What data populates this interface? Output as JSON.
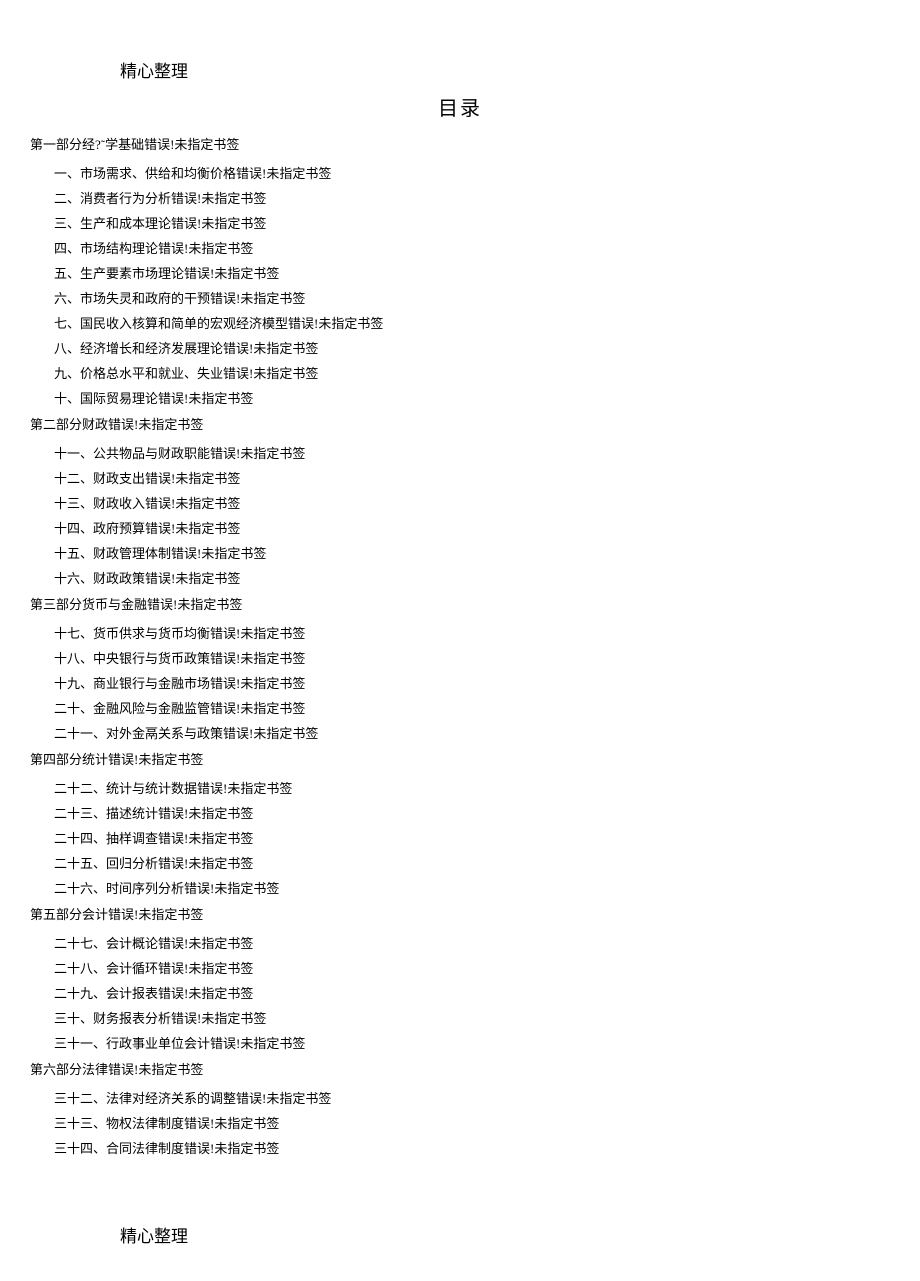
{
  "header": "精心整理",
  "footer": "精心整理",
  "title": "目录",
  "errorSuffix": "错误!未指定书签",
  "sections": [
    {
      "title": "第一部分经?˜学基础",
      "items": [
        "一、市场需求、供给和均衡价格",
        "二、消费者行为分析",
        "三、生产和成本理论",
        "四、市场结构理论",
        "五、生产要素市场理论",
        "六、市场失灵和政府的干预",
        "七、国民收入核算和简单的宏观经济模型",
        "八、经济增长和经济发展理论",
        "九、价格总水平和就业、失业",
        "十、国际贸易理论"
      ]
    },
    {
      "title": "第二部分财政",
      "items": [
        "十一、公共物品与财政职能",
        "十二、财政支出",
        "十三、财政收入",
        "十四、政府预算",
        "十五、财政管理体制",
        "十六、财政政策"
      ]
    },
    {
      "title": "第三部分货币与金融",
      "items": [
        "十七、货币供求与货币均衡",
        "十八、中央银行与货币政策",
        "十九、商业银行与金融市场",
        "二十、金融风险与金融监管",
        "二十一、对外金鬲关系与政策"
      ]
    },
    {
      "title": "第四部分统计",
      "items": [
        "二十二、统计与统计数据",
        "二十三、描述统计",
        "二十四、抽样调查",
        "二十五、回归分析",
        "二十六、时间序列分析"
      ]
    },
    {
      "title": "第五部分会计",
      "items": [
        "二十七、会计概论",
        "二十八、会计循环",
        "二十九、会计报表",
        "三十、财务报表分析",
        "三十一、行政事业单位会计"
      ]
    },
    {
      "title": "第六部分法律",
      "items": [
        "三十二、法律对经济关系的调整",
        "三十三、物权法律制度",
        "三十四、合同法律制度"
      ]
    }
  ]
}
